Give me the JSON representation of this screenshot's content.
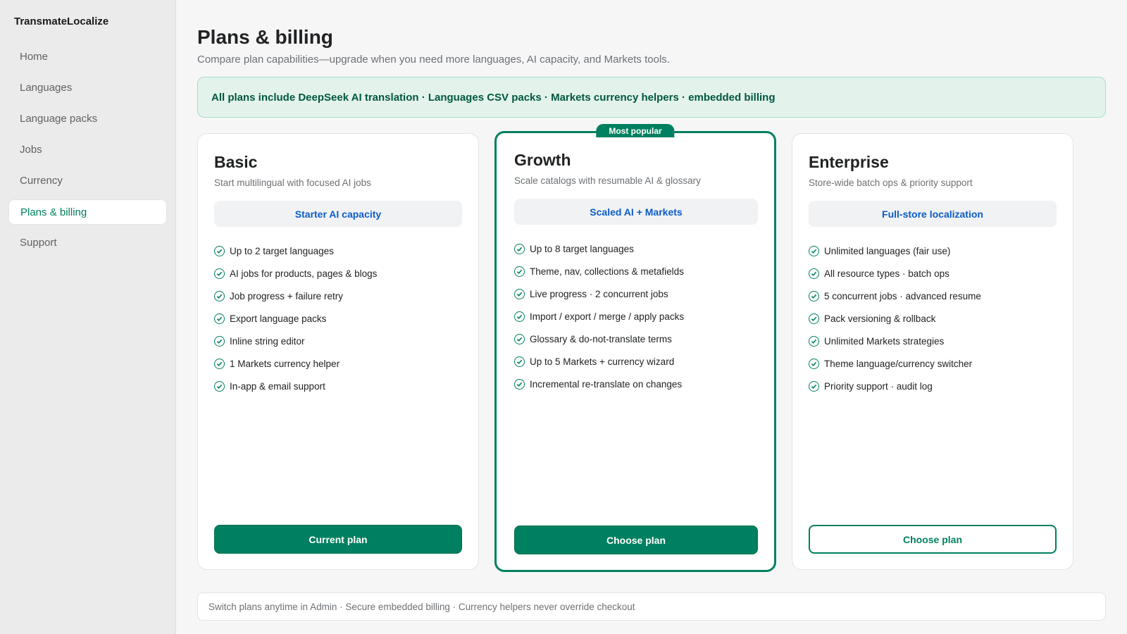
{
  "app": {
    "name": "TransmateLocalize"
  },
  "sidebar": {
    "items": [
      {
        "label": "Home",
        "active": false
      },
      {
        "label": "Languages",
        "active": false
      },
      {
        "label": "Language packs",
        "active": false
      },
      {
        "label": "Jobs",
        "active": false
      },
      {
        "label": "Currency",
        "active": false
      },
      {
        "label": "Plans & billing",
        "active": true
      },
      {
        "label": "Support",
        "active": false
      }
    ]
  },
  "header": {
    "title": "Plans & billing",
    "subtitle": "Compare plan capabilities—upgrade when you need more languages, AI capacity, and Markets tools."
  },
  "banner": {
    "text": "All plans include DeepSeek AI translation · Languages CSV packs · Markets currency helpers · embedded billing"
  },
  "plans": [
    {
      "name": "Basic",
      "description": "Start multilingual with focused AI jobs",
      "tag": "Starter AI capacity",
      "features": [
        "Up to 2 target languages",
        "AI jobs for products, pages & blogs",
        "Job progress + failure retry",
        "Export language packs",
        "Inline string editor",
        "1 Markets currency helper",
        "In-app & email support"
      ],
      "button": "Current plan"
    },
    {
      "name": "Growth",
      "badge": "Most popular",
      "description": "Scale catalogs with resumable AI & glossary",
      "tag": "Scaled AI + Markets",
      "features": [
        "Up to 8 target languages",
        "Theme, nav, collections & metafields",
        "Live progress · 2 concurrent jobs",
        "Import / export / merge / apply packs",
        "Glossary & do-not-translate terms",
        "Up to 5 Markets + currency wizard",
        "Incremental re-translate on changes"
      ],
      "button": "Choose plan"
    },
    {
      "name": "Enterprise",
      "description": "Store-wide batch ops & priority support",
      "tag": "Full-store localization",
      "features": [
        "Unlimited languages (fair use)",
        "All resource types · batch ops",
        "5 concurrent jobs · advanced resume",
        "Pack versioning & rollback",
        "Unlimited Markets strategies",
        "Theme language/currency switcher",
        "Priority support · audit log"
      ],
      "button": "Choose plan"
    }
  ],
  "footer": {
    "note": "Switch plans anytime in Admin · Secure embedded billing · Currency helpers never override checkout"
  },
  "colors": {
    "accent": "#008060",
    "tag_text": "#0b5cc9",
    "banner_bg": "#e3f3ec"
  }
}
